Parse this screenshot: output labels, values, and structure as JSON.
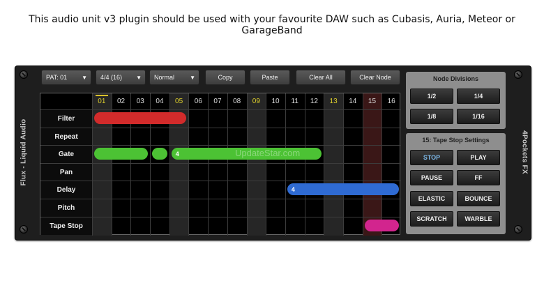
{
  "caption": "This audio unit v3 plugin should be used with your favourite DAW such as Cubasis, Auria, Meteor or GarageBand",
  "side_left": "Flux - Liquid Audio",
  "side_right": "4Pockets FX",
  "toolbar": {
    "pattern": "PAT: 01",
    "time_sig": "4/4 (16)",
    "mode": "Normal",
    "copy": "Copy",
    "paste": "Paste",
    "clear_all": "Clear All",
    "clear_node": "Clear Node",
    "dropdown_arrow": "▼"
  },
  "grid": {
    "columns": [
      "01",
      "02",
      "03",
      "04",
      "05",
      "06",
      "07",
      "08",
      "09",
      "10",
      "11",
      "12",
      "13",
      "14",
      "15",
      "16"
    ],
    "highlight_columns": [
      1,
      5,
      9,
      13
    ],
    "current_step": 1,
    "rows": [
      "Filter",
      "Repeat",
      "Gate",
      "Pan",
      "Delay",
      "Pitch",
      "Tape Stop"
    ],
    "bars": [
      {
        "row": "Filter",
        "start": 1,
        "end": 5,
        "color": "#d22b2b",
        "label": ""
      },
      {
        "row": "Gate",
        "start": 1,
        "end": 3,
        "color": "#4cc234",
        "label": ""
      },
      {
        "row": "Gate",
        "start": 4,
        "end": 4,
        "color": "#4cc234",
        "label": ""
      },
      {
        "row": "Gate",
        "start": 5,
        "end": 12,
        "color": "#4cc234",
        "label": "4"
      },
      {
        "row": "Delay",
        "start": 11,
        "end": 16,
        "color": "#2f6bd3",
        "label": "4"
      },
      {
        "row": "Tape Stop",
        "start": 15,
        "end": 16,
        "color": "#d2258e",
        "label": ""
      }
    ],
    "dimmed_column": 15
  },
  "watermark": "UpdateStar.com",
  "node_divisions": {
    "title": "Node Divisions",
    "buttons": [
      "1/2",
      "1/4",
      "1/8",
      "1/16"
    ]
  },
  "tape_stop": {
    "title": "15: Tape Stop Settings",
    "buttons": [
      "STOP",
      "PLAY",
      "PAUSE",
      "FF",
      "ELASTIC",
      "BOUNCE",
      "SCRATCH",
      "WARBLE"
    ],
    "active": "STOP"
  }
}
